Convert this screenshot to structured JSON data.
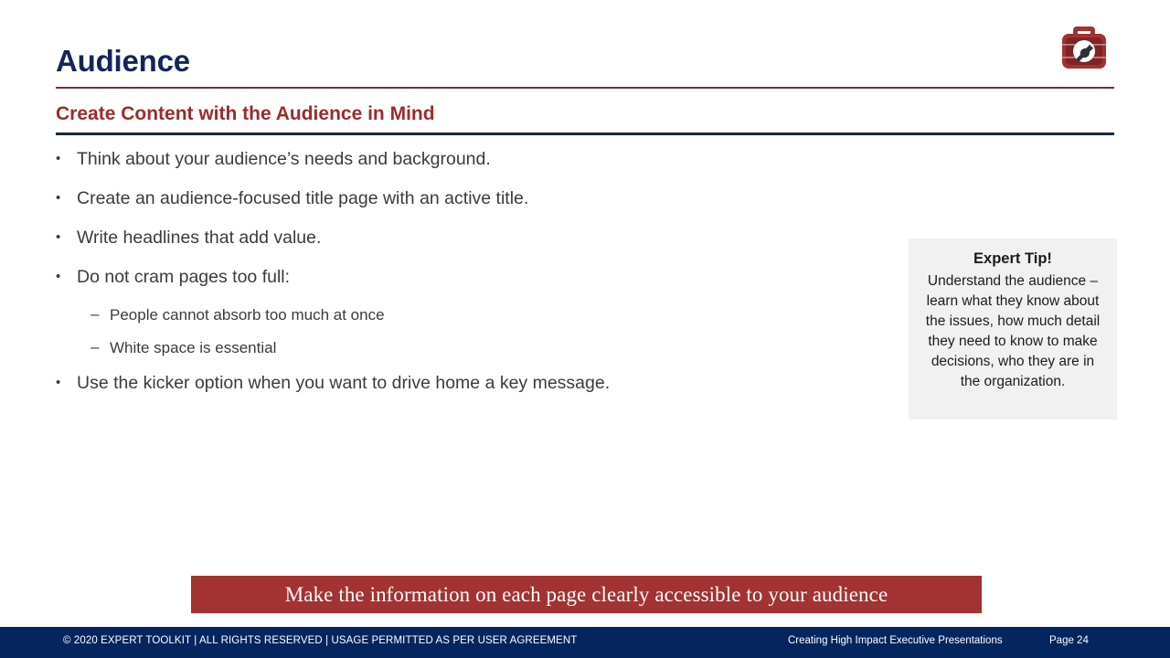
{
  "slide": {
    "title": "Audience",
    "subtitle": "Create Content with the Audience in Mind",
    "logo_name": "expert-toolkit-logo"
  },
  "bullets": [
    {
      "marker": "•",
      "level": 1,
      "text": "Think about your audience’s needs and background."
    },
    {
      "marker": "•",
      "level": 1,
      "text": "Create an audience-focused title page with an active title."
    },
    {
      "marker": "•",
      "level": 1,
      "text": "Write headlines that add value."
    },
    {
      "marker": "•",
      "level": 1,
      "text": "Do not cram pages too full:"
    },
    {
      "marker": "–",
      "level": 2,
      "text": "People cannot absorb too much at once"
    },
    {
      "marker": "–",
      "level": 2,
      "text": "White space is essential"
    },
    {
      "marker": "•",
      "level": 1,
      "text": "Use the kicker option when you want to drive home a key message."
    }
  ],
  "tip": {
    "title": "Expert Tip!",
    "body": "Understand the audience – learn what they know about the issues, how much detail they need to know to make decisions, who they are in the organization."
  },
  "kicker": {
    "text": "Make the information on each page clearly accessible to your audience"
  },
  "footer": {
    "copyright": "© 2020 EXPERT TOOLKIT | ALL RIGHTS RESERVED | USAGE PERMITTED AS PER USER AGREEMENT",
    "deck_title": "Creating High Impact Executive Presentations",
    "page": "Page 24"
  },
  "colors": {
    "title_navy": "#14255C",
    "subtitle_maroon": "#9B2B2B",
    "rule_maroon": "#6B3334",
    "rule_navy": "#16283F",
    "kicker_red": "#A33233",
    "footer_navy": "#05255F",
    "tip_background": "#F1F1F1",
    "body_text": "#3B3B3B"
  }
}
